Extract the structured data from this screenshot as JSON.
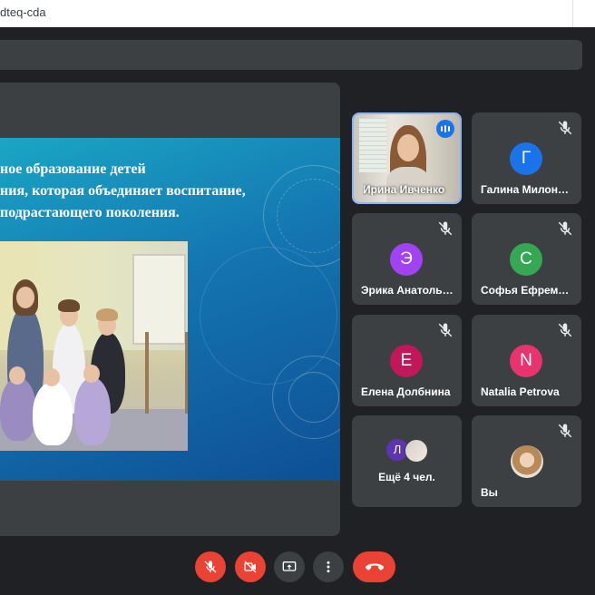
{
  "browser": {
    "url_fragment": "dteq-cda"
  },
  "slide": {
    "lines": [
      "ное образование детей",
      "ния, которая объединяет воспитание,",
      "подрастающего поколения."
    ]
  },
  "participants": [
    {
      "name": "Ирина Ивченко",
      "video": true,
      "speaking": true
    },
    {
      "name": "Галина Милоно…",
      "initial": "Г",
      "color": "#1a73e8",
      "muted": true
    },
    {
      "name": "Эрика Анатоль…",
      "initial": "Э",
      "color": "#a142f4",
      "muted": true
    },
    {
      "name": "Софья Ефремова",
      "initial": "С",
      "color": "#34a853",
      "muted": true
    },
    {
      "name": "Елена Долбнина",
      "initial": "Е",
      "color": "#c2185b",
      "muted": true
    },
    {
      "name": "Natalia Petrova",
      "initial": "N",
      "color": "#e8336e",
      "muted": true
    },
    {
      "name": "Ещё 4 чел.",
      "avatar_initial": "Л",
      "more": true
    },
    {
      "name": "Вы",
      "self": true,
      "muted": true
    }
  ],
  "controls": [
    "mic-off-icon",
    "camera-off-icon",
    "present-screen-icon",
    "more-options-icon",
    "end-call-icon"
  ],
  "colors": {
    "danger": "#ea4335",
    "tile": "#3c4043",
    "background": "#202124",
    "active_border": "#8ab4f8"
  }
}
